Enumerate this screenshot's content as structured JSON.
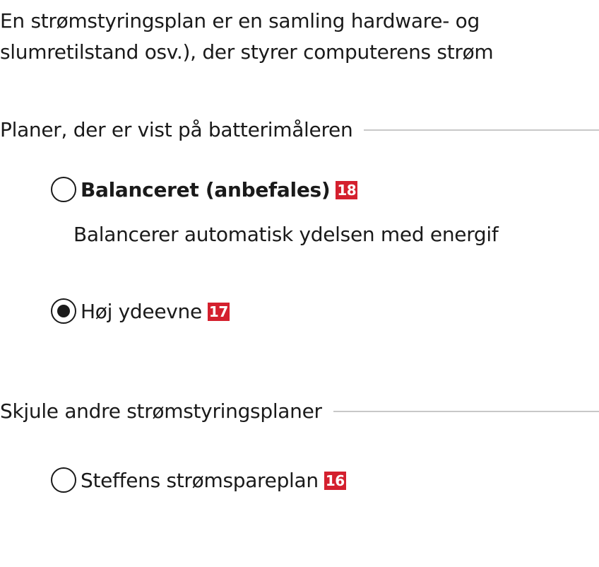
{
  "intro": {
    "line1": "En strømstyringsplan er en samling hardware- og",
    "line2": "slumretilstand osv.), der styrer computerens strøm"
  },
  "battery_meter_group": {
    "header": "Planer, der er vist på batterimåleren",
    "plans": [
      {
        "label": "Balanceret (anbefales)",
        "badge": "18",
        "selected": false,
        "description": "Balancerer automatisk ydelsen med energif"
      },
      {
        "label": "Høj ydeevne",
        "badge": "17",
        "selected": true
      }
    ]
  },
  "hidden_group": {
    "header": "Skjule andre strømstyringsplaner",
    "plans": [
      {
        "label": "Steffens strømspareplan",
        "badge": "16",
        "selected": false
      }
    ]
  },
  "colors": {
    "badge_bg": "#d4202e",
    "text": "#1a1a1a",
    "separator": "#c8c8c8"
  }
}
